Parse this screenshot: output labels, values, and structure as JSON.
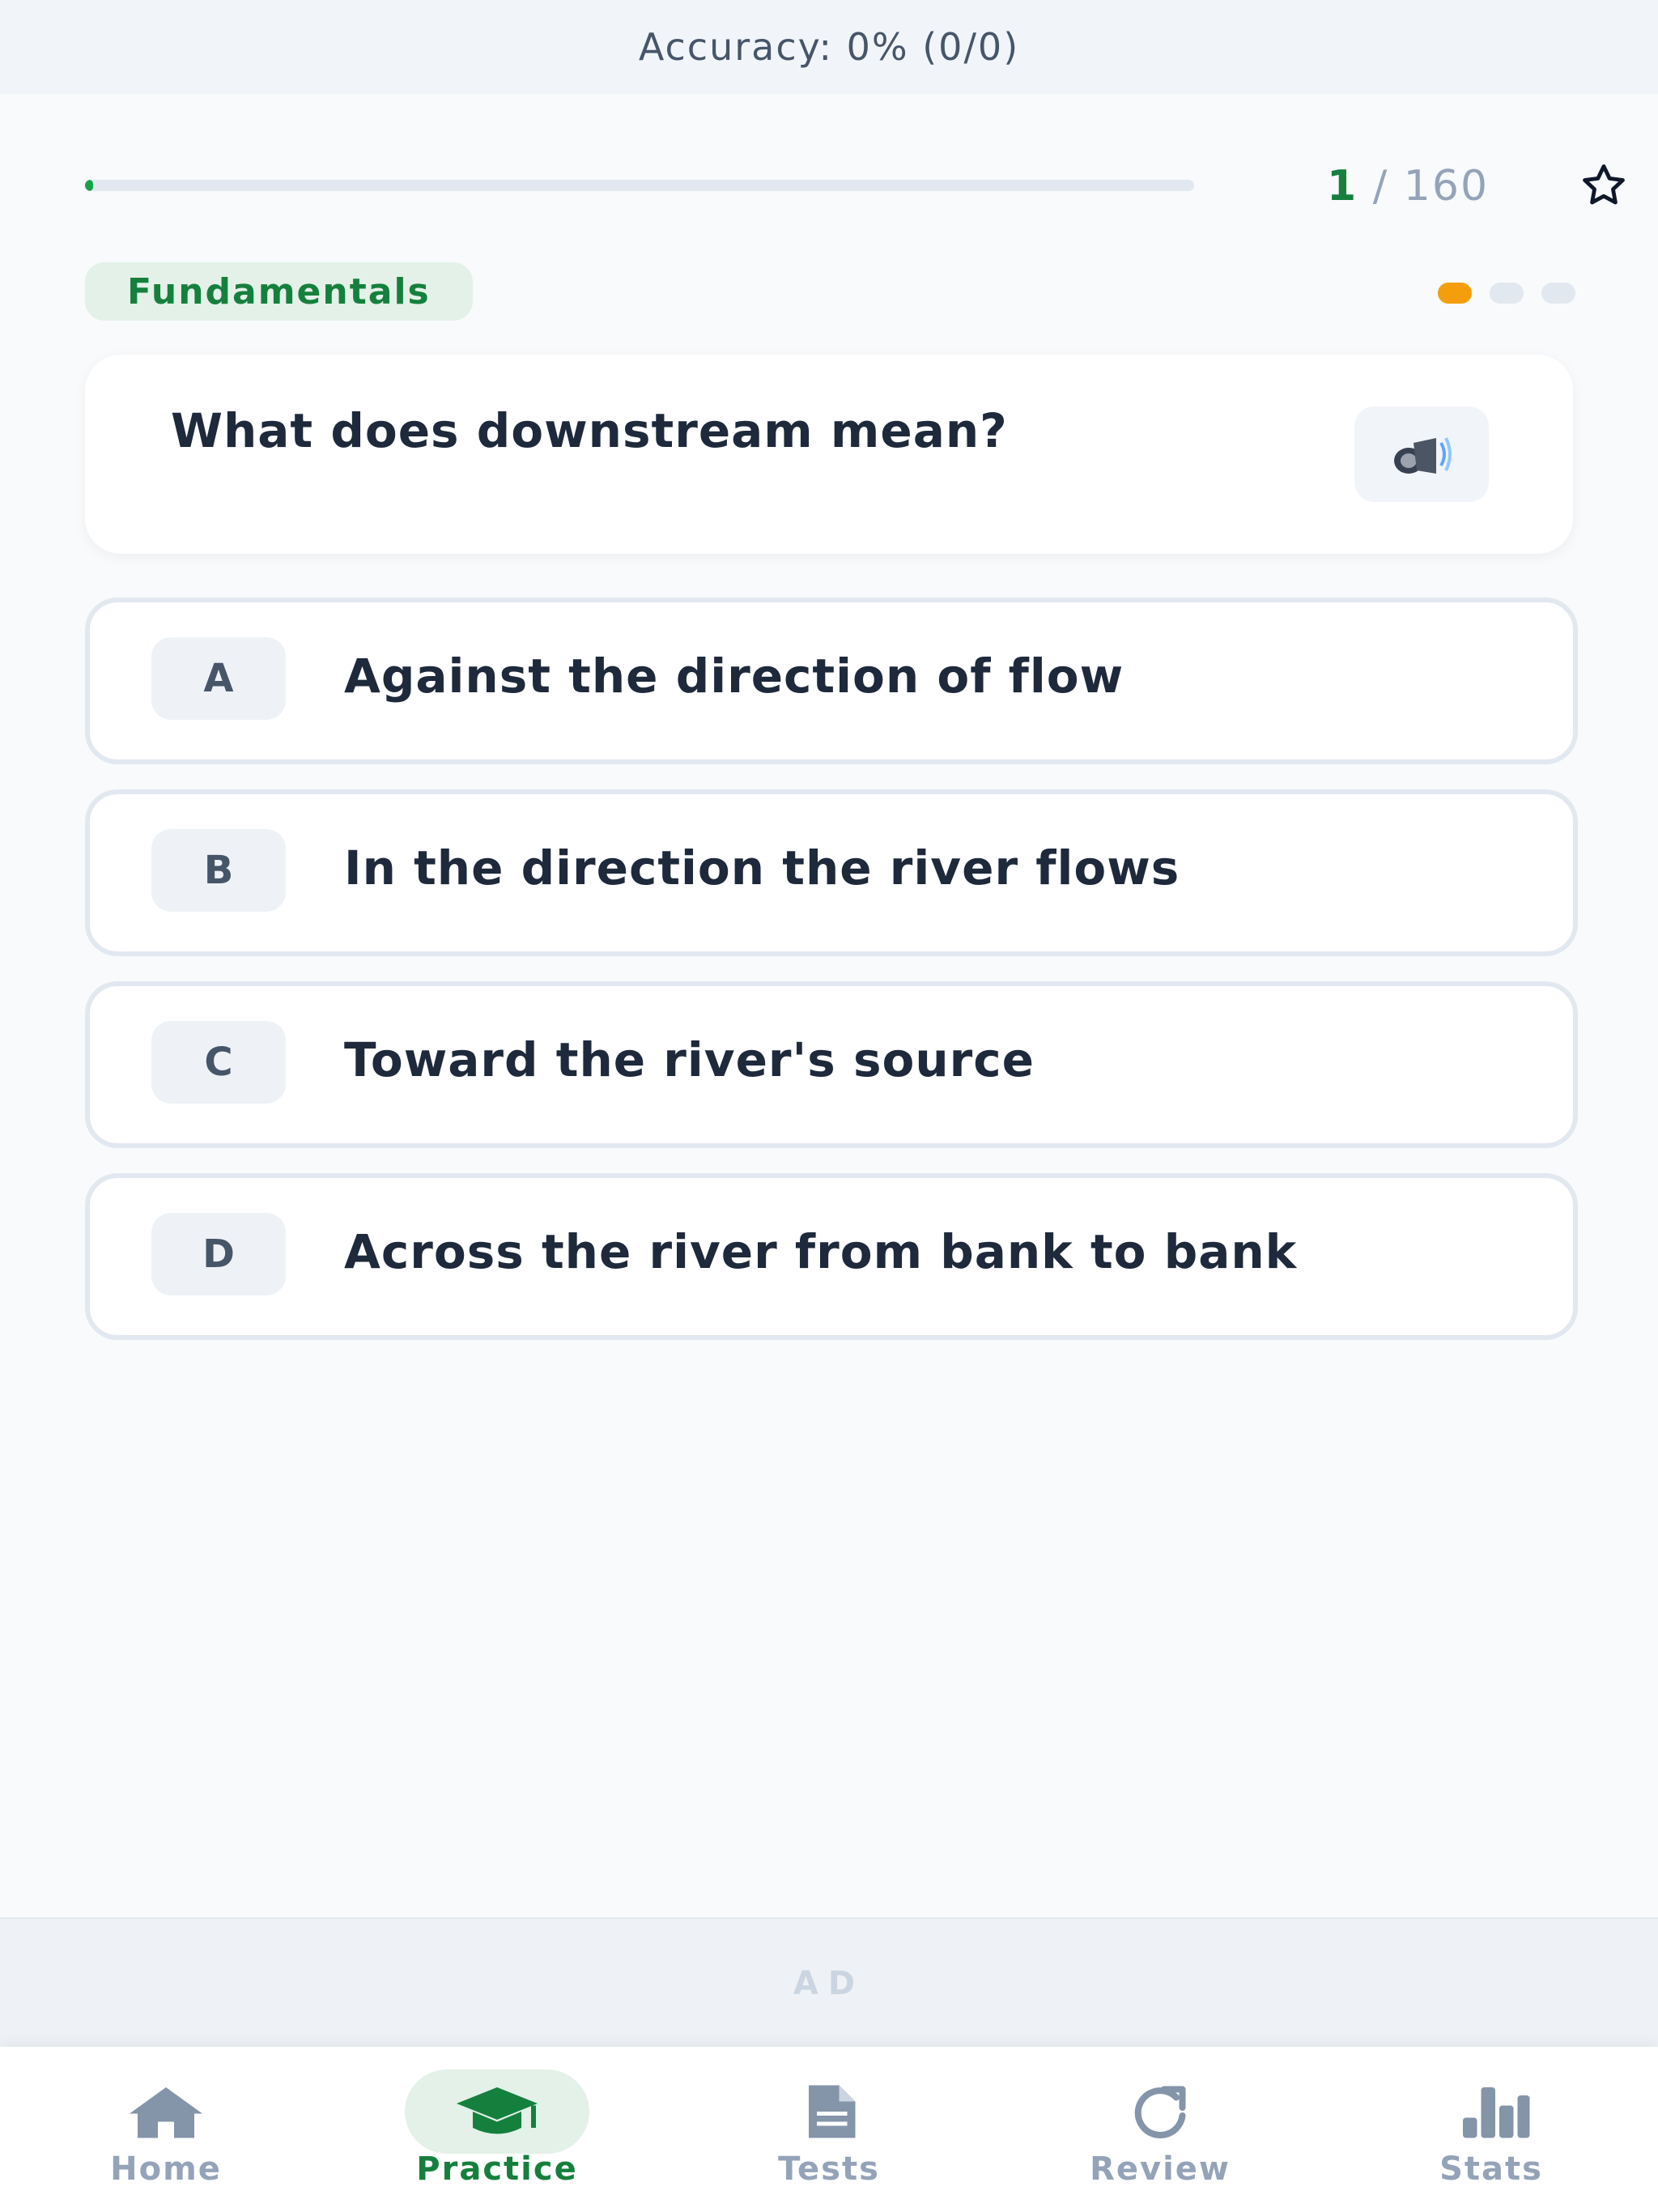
{
  "header": {
    "accuracy_text": "Accuracy: 0% (0/0)"
  },
  "progress": {
    "current": "1",
    "separator": "/",
    "total": "160",
    "fraction": 0.00625
  },
  "question": {
    "category": "Fundamentals",
    "text": "What does downstream mean?",
    "audio_icon": "speaker-icon",
    "favorite_icon": "star-outline-icon"
  },
  "page_dots": {
    "count": 3,
    "active_index": 0
  },
  "options": [
    {
      "letter": "A",
      "text": "Against the direction of flow"
    },
    {
      "letter": "B",
      "text": "In the direction the river flows"
    },
    {
      "letter": "C",
      "text": "Toward the river's source"
    },
    {
      "letter": "D",
      "text": "Across the river from bank to bank"
    }
  ],
  "ad": {
    "label": "AD"
  },
  "tabs": [
    {
      "label": "Home",
      "icon": "home-icon",
      "active": false
    },
    {
      "label": "Practice",
      "icon": "graduation-cap-icon",
      "active": true
    },
    {
      "label": "Tests",
      "icon": "document-icon",
      "active": false
    },
    {
      "label": "Review",
      "icon": "refresh-icon",
      "active": false
    },
    {
      "label": "Stats",
      "icon": "bar-chart-icon",
      "active": false
    }
  ],
  "colors": {
    "accent_green": "#15803d",
    "dot_active": "#f59e0b",
    "inactive": "#94a3b8",
    "background": "#f8fafc"
  }
}
